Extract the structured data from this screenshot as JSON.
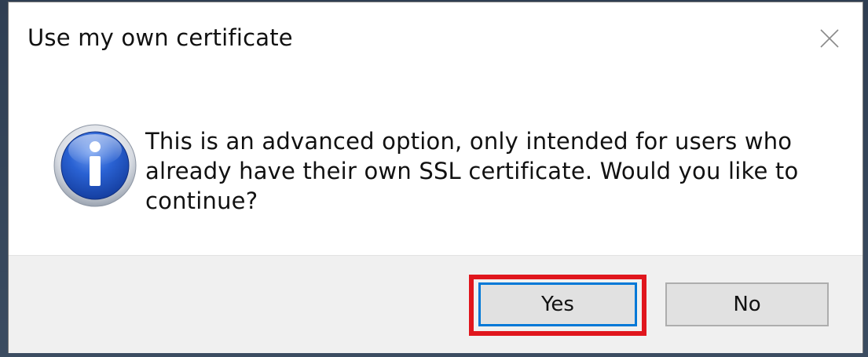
{
  "dialog": {
    "title": "Use my own certificate",
    "message": "This is an advanced option, only intended for users who already have their own SSL certificate. Would you like to continue?",
    "icon": "information-icon",
    "close_icon": "close-icon"
  },
  "buttons": {
    "yes_label": "Yes",
    "no_label": "No"
  },
  "annotation": {
    "highlight_target": "yes-button",
    "highlight_color": "#e0161d"
  },
  "colors": {
    "dialog_bg": "#ffffff",
    "footer_bg": "#f0f0f0",
    "focus_border": "#0078d7",
    "icon_blue": "#1d57c7"
  }
}
